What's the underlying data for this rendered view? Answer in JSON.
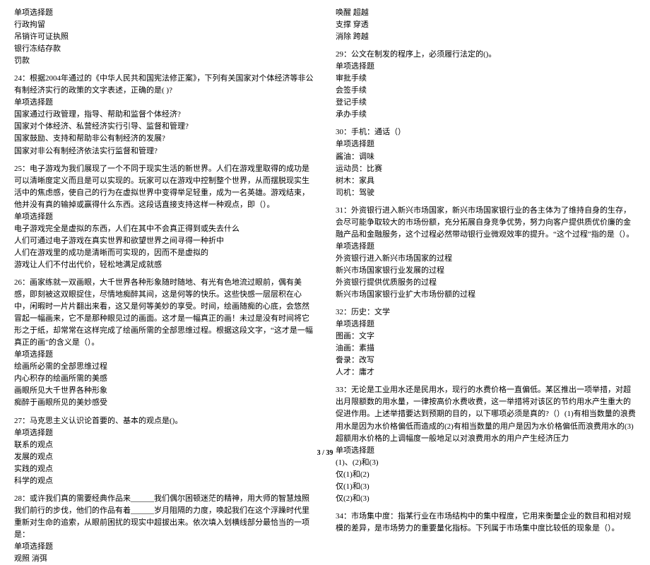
{
  "footer": "3 / 39",
  "left": {
    "pre": [
      "单项选择题",
      "行政拘留",
      "吊销许可证执照",
      "银行冻结存款",
      "罚款"
    ],
    "q24": {
      "stem": "24：根据2004年通过的《中华人民共和国宪法修正案》，下列有关国家对个体经济等非公有制经济实行的政策的文字表述，正确的是(   )?",
      "type": "单项选择题",
      "opts": [
        "国家通过行政管理，指导、帮助和监督个体经济?",
        "国家对个体经济、私营经济实行引导、监督和管理?",
        "国家鼓励、支持和帮助非公有制经济的发展?",
        "国家对非公有制经济依法实行监督和管理?"
      ]
    },
    "q25": {
      "stem": "25：电子游戏为我们展现了一个不同于现实生活的新世界。人们在游戏里取得的成功是可以清晰度定义而且是可以实现的。玩家可以在游戏中控制整个世界，从而摆脱现实生活中的焦虑感，使自己的行为在虚拟世界中变得举足轻重，成为一名英雄。游戏结束，他并没有真的输掉或赢得什么东西。这段话直接支持这样一种观点，即（）。",
      "type": "单项选择题",
      "opts": [
        "电子游戏完全是虚拟的东西，人们在其中不会真正得到或失去什么",
        "人们可通过电子游戏在真实世界和欲望世界之间寻得一种折中",
        "人们在游戏里的成功是清晰而可实现的，因而不是虚拟的",
        "游戏让人们不付出代价，轻松地满足成就感"
      ]
    },
    "q26": {
      "stem": "26：画家练就一双画眼，大千世界各种形象随时随地、有光有色地流过眼前，偶有美感，即刻被这双眼捉住，尽情地痴醉其间，这是何等的快乐。这些快感一层层积在心中，闲暇时一片片翻出来看，这又是何等美妙的享受。时间，绘画随痴的心底，会悠然冒起一幅画来，它不是那种眼见过的画面。这才是一幅真正的画！未过是没有时间将它形之于纸，却常常在这样完成了绘画所需的全部思维过程。根据这段文字，“这才是一幅真正的画”的含义是（）。",
      "type": "单项选择题",
      "opts": [
        "绘画所必需的全部思维过程",
        "内心积存的绘画所需的美感",
        "画眼所见大千世界各种形象",
        "痴醉于画眼所见的美妙感受"
      ]
    },
    "q27": {
      "stem": "27：马克思主义认识论首要的、基本的观点是()。",
      "type": "单项选择题",
      "opts": [
        "联系的观点",
        "发展的观点",
        "实践的观点",
        "科学的观点"
      ]
    },
    "q28": {
      "stem": "28：或许我们真的需要经典作品来______我们偶尔困顿迷茫的精神，用大师的智慧烛照我们前行的步伐，他们的作品有着______岁月阻隔的力度，唤起我们在这个浮躁时代里重新对生命的追索，从眼前困扰的现实中超拔出来。依次填入划横线部分最恰当的一项是：",
      "type": "单项选择题",
      "opts": [
        "观照 消弭"
      ]
    }
  },
  "right": {
    "pre": [
      "唤醒 超越",
      "支撑 穿透",
      "消除 跨越"
    ],
    "q29": {
      "stem": "29：公文在制发的程序上，必须履行法定的()。",
      "type": "单项选择题",
      "opts": [
        "审批手续",
        "会签手续",
        "登记手续",
        "承办手续"
      ]
    },
    "q30": {
      "stem": "30：手机：通话（）",
      "type": "单项选择题",
      "opts": [
        "酱油：调味",
        "运动员：比赛",
        "树木：家具",
        "司机：驾驶"
      ]
    },
    "q31": {
      "stem": "31：外资银行进入新兴市场国家，新兴市场国家银行业的各主体为了维持自身的生存，会尽可能争取较大的市场份额，充分拓展自身竞争优势，努力向客户提供质优价廉的金融产品和金融服务，这个过程必然带动银行业微观效率的提升。“这个过程”指的是（）。",
      "type": "单项选择题",
      "opts": [
        "外资银行进入新兴市场国家的过程",
        "新兴市场国家银行业发展的过程",
        "外资银行提供优质服务的过程",
        "新兴市场国家银行业扩大市场份额的过程"
      ]
    },
    "q32": {
      "stem": "32：历史：文学",
      "type": "单项选择题",
      "opts": [
        "图画：文字",
        "油画：素描",
        "誊录：改写",
        "人才：庸才"
      ]
    },
    "q33": {
      "stem": "33：无论是工业用水还是民用水，现行的水费价格一直偏低。某区推出一项举措，对超出月限额数的用水量，一律按高价水费收费，这一举措将对该区的节约用水产生重大的促进作用。上述举措要达到预期的目的，以下哪项必须是真的?（）(1)有相当数量的浪费用水是因为水价格偏低而造成的(2)有相当数量的用户是因为水价格偏低而浪费用水的(3)超额用水价格的上调幅度一般地足以对浪费用水的用户产生经济压力",
      "type": "单项选择题",
      "opts": [
        "(1)、(2)和(3)",
        "仅(1)和(2)",
        "仅(1)和(3)",
        "仅(2)和(3)"
      ]
    },
    "q34": {
      "stem": "34：市场集中度：指某行业在市场结构中的集中程度，它用来衡量企业的数目和相对规模的差异，是市场势力的重要量化指标。下列属于市场集中度比较低的现象是（）。"
    }
  }
}
